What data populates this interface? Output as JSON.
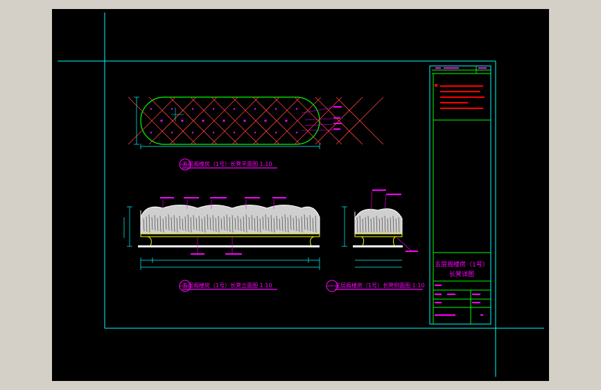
{
  "drawing": {
    "plan_title": "五层阁楼房（1号）长凳平面图 1:10",
    "front_title": "五层阁楼房（1号）长凳立面图 1:10",
    "side_title": "五层阁楼房（1号）长凳侧面图 1:10",
    "title_block": {
      "project_line1": "五层阁楼房（1号）",
      "project_line2": "长凳详图"
    }
  },
  "colors": {
    "background": "#000000",
    "frame": "#00ffff",
    "title_block": "#00ff00",
    "annotation": "#ff00ff",
    "notes": "#ff0000",
    "seat_outline": "#ffff00",
    "cushion": "#ffffff"
  }
}
